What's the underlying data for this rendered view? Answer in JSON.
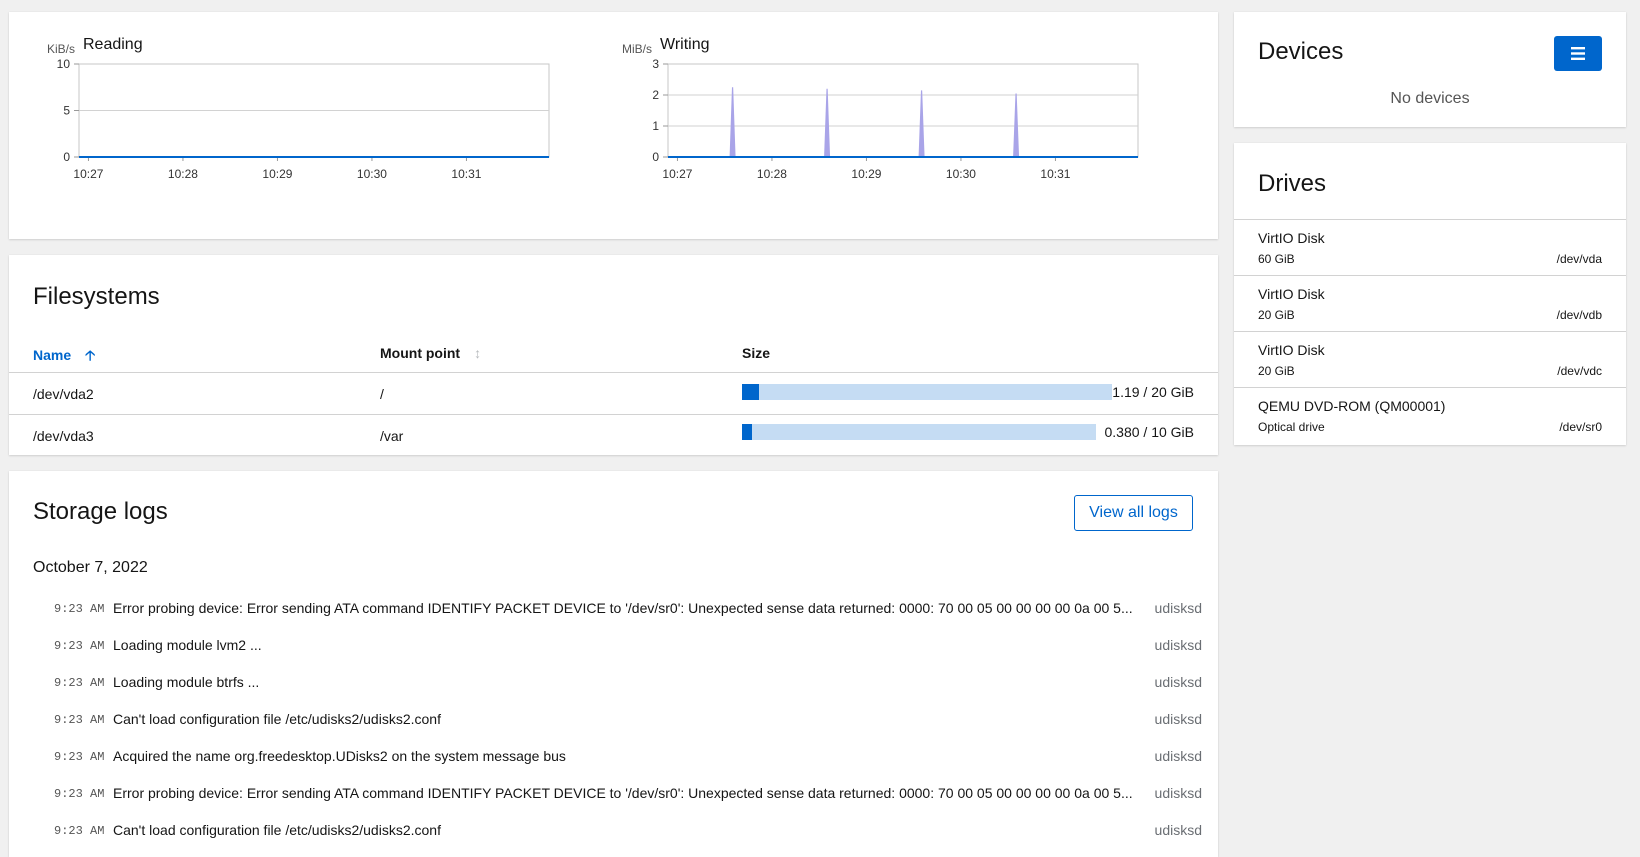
{
  "graphs": {
    "reading": {
      "title": "Reading",
      "unit": "KiB/s",
      "y_ticks": [
        "10",
        "5",
        "0"
      ],
      "x_ticks": [
        "10:27",
        "10:28",
        "10:29",
        "10:30",
        "10:31"
      ]
    },
    "writing": {
      "title": "Writing",
      "unit": "MiB/s",
      "y_ticks": [
        "3",
        "2",
        "1",
        "0"
      ],
      "x_ticks": [
        "10:27",
        "10:28",
        "10:29",
        "10:30",
        "10:31"
      ]
    },
    "colors": {
      "line": "#0066cc",
      "spike": "#a9a4e8"
    }
  },
  "chart_data": [
    {
      "type": "area",
      "title": "Reading",
      "ylabel": "KiB/s",
      "ylim": [
        0,
        10
      ],
      "x_ticks": [
        "10:27",
        "10:28",
        "10:29",
        "10:30",
        "10:31"
      ],
      "series": [
        {
          "values": [
            0,
            0,
            0,
            0,
            0
          ]
        }
      ]
    },
    {
      "type": "area",
      "title": "Writing",
      "ylabel": "MiB/s",
      "ylim": [
        0,
        3
      ],
      "x_ticks": [
        "10:27",
        "10:28",
        "10:29",
        "10:30",
        "10:31"
      ],
      "series": [
        {
          "spikes_at": [
            "10:27:35",
            "10:28:35",
            "10:29:35",
            "10:30:35"
          ],
          "spike_values": [
            2.25,
            2.2,
            2.15,
            2.05
          ]
        }
      ]
    }
  ],
  "filesystems": {
    "title": "Filesystems",
    "columns": {
      "name": "Name",
      "mount": "Mount point",
      "size": "Size"
    },
    "rows": [
      {
        "name": "/dev/vda2",
        "mount": "/",
        "size_label": "1.19 / 20 GiB",
        "used_fraction": 0.0595
      },
      {
        "name": "/dev/vda3",
        "mount": "/var",
        "size_label": "0.380 / 10 GiB",
        "used_fraction": 0.038
      }
    ]
  },
  "logs": {
    "title": "Storage logs",
    "view_all": "View all logs",
    "date": "October 7, 2022",
    "entries": [
      {
        "time": "9:23 AM",
        "message": "Error probing device: Error sending ATA command IDENTIFY PACKET DEVICE to '/dev/sr0': Unexpected sense data returned: 0000: 70 00 05 00 00 00 00 0a 00 5...",
        "source": "udisksd"
      },
      {
        "time": "9:23 AM",
        "message": "Loading module lvm2 ...",
        "source": "udisksd"
      },
      {
        "time": "9:23 AM",
        "message": "Loading module btrfs ...",
        "source": "udisksd"
      },
      {
        "time": "9:23 AM",
        "message": "Can't load configuration file /etc/udisks2/udisks2.conf",
        "source": "udisksd"
      },
      {
        "time": "9:23 AM",
        "message": "Acquired the name org.freedesktop.UDisks2 on the system message bus",
        "source": "udisksd"
      },
      {
        "time": "9:23 AM",
        "message": "Error probing device: Error sending ATA command IDENTIFY PACKET DEVICE to '/dev/sr0': Unexpected sense data returned: 0000: 70 00 05 00 00 00 00 0a 00 5...",
        "source": "udisksd"
      },
      {
        "time": "9:23 AM",
        "message": "Can't load configuration file /etc/udisks2/udisks2.conf",
        "source": "udisksd"
      }
    ]
  },
  "devices": {
    "title": "Devices",
    "empty": "No devices",
    "menu_icon": "bars-icon"
  },
  "drives": {
    "title": "Drives",
    "items": [
      {
        "name": "VirtIO Disk",
        "size": "60 GiB",
        "path": "/dev/vda"
      },
      {
        "name": "VirtIO Disk",
        "size": "20 GiB",
        "path": "/dev/vdb"
      },
      {
        "name": "VirtIO Disk",
        "size": "20 GiB",
        "path": "/dev/vdc"
      },
      {
        "name": "QEMU DVD-ROM (QM00001)",
        "size": "Optical drive",
        "path": "/dev/sr0"
      }
    ]
  }
}
